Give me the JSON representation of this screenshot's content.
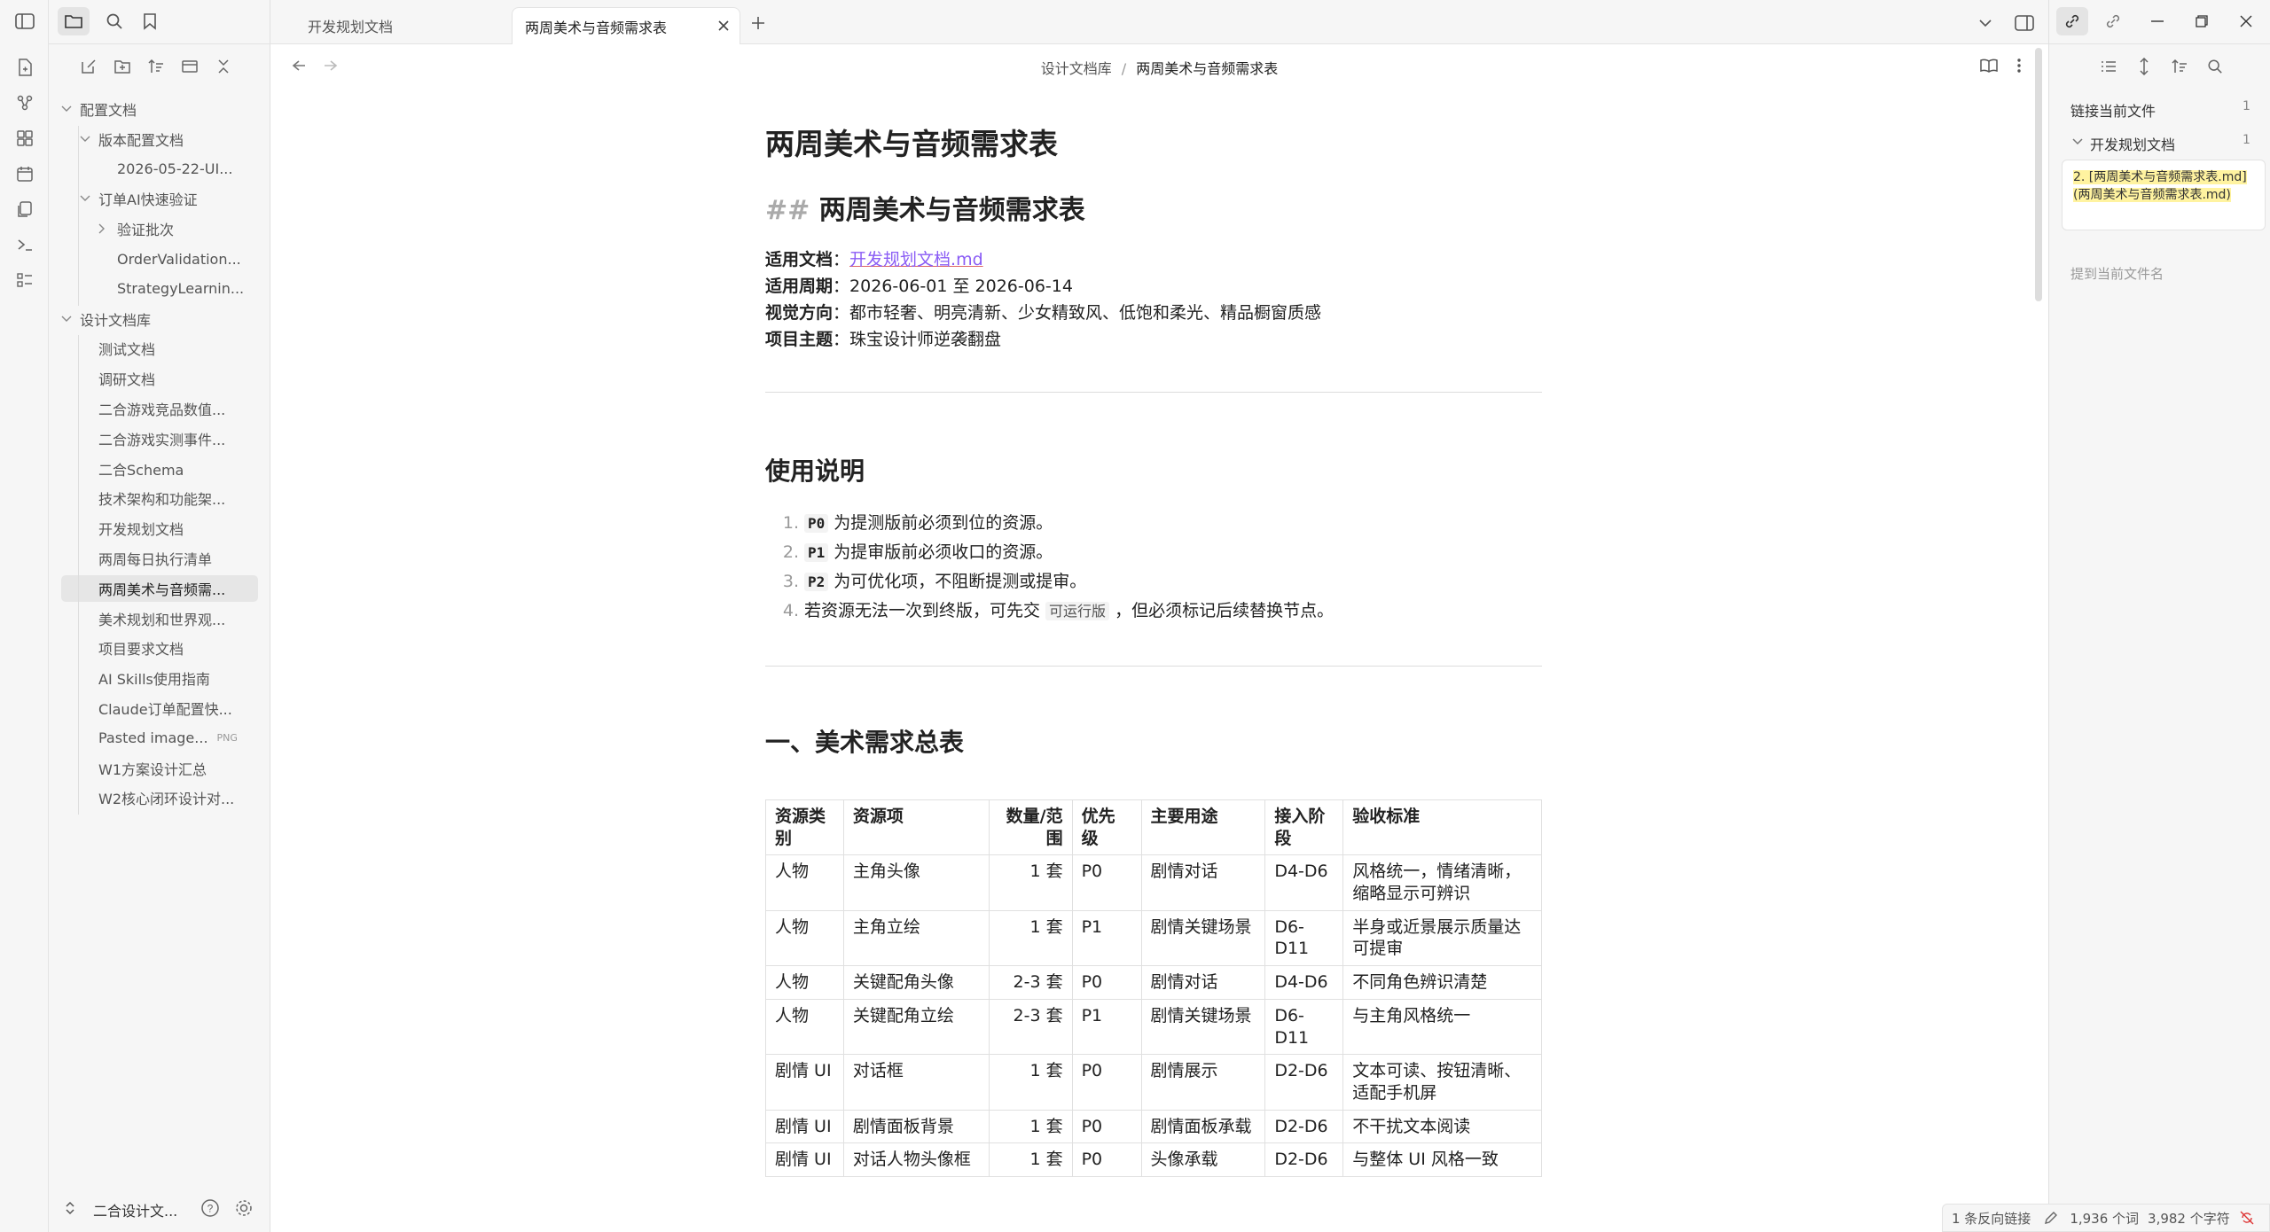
{
  "ribbon": {
    "icons": [
      "sidebar-toggle-icon",
      "new-note-icon",
      "graph-icon",
      "canvas-icon",
      "calendar-icon",
      "templates-icon",
      "terminal-icon",
      "command-palette-icon"
    ]
  },
  "sidebar": {
    "toolbar_icons": [
      "new-note-icon",
      "new-folder-icon",
      "sort-icon",
      "collapse-icon",
      "close-all-icon"
    ],
    "tree": [
      {
        "label": "配置文档",
        "depth": 0,
        "type": "folder-open"
      },
      {
        "label": "版本配置文档",
        "depth": 1,
        "type": "folder-open"
      },
      {
        "label": "2026-05-22-UI...",
        "depth": 2,
        "type": "file"
      },
      {
        "label": "订单AI快速验证",
        "depth": 1,
        "type": "folder-open"
      },
      {
        "label": "验证批次",
        "depth": 2,
        "type": "folder-closed"
      },
      {
        "label": "OrderValidation...",
        "depth": 2,
        "type": "file"
      },
      {
        "label": "StrategyLearnin...",
        "depth": 2,
        "type": "file"
      },
      {
        "label": "设计文档库",
        "depth": 0,
        "type": "folder-open"
      },
      {
        "label": "测试文档",
        "depth": 1,
        "type": "file"
      },
      {
        "label": "调研文档",
        "depth": 1,
        "type": "file"
      },
      {
        "label": "二合游戏竞品数值...",
        "depth": 1,
        "type": "file"
      },
      {
        "label": "二合游戏实测事件...",
        "depth": 1,
        "type": "file"
      },
      {
        "label": "二合Schema",
        "depth": 1,
        "type": "file"
      },
      {
        "label": "技术架构和功能架...",
        "depth": 1,
        "type": "file"
      },
      {
        "label": "开发规划文档",
        "depth": 1,
        "type": "file"
      },
      {
        "label": "两周每日执行清单",
        "depth": 1,
        "type": "file"
      },
      {
        "label": "两周美术与音频需...",
        "depth": 1,
        "type": "file",
        "selected": true
      },
      {
        "label": "美术规划和世界观...",
        "depth": 1,
        "type": "file"
      },
      {
        "label": "项目要求文档",
        "depth": 1,
        "type": "file"
      },
      {
        "label": "AI Skills使用指南",
        "depth": 1,
        "type": "file"
      },
      {
        "label": "Claude订单配置快...",
        "depth": 1,
        "type": "file"
      },
      {
        "label": "Pasted image...",
        "depth": 1,
        "type": "file",
        "badge": "PNG"
      },
      {
        "label": "W1方案设计汇总",
        "depth": 1,
        "type": "file"
      },
      {
        "label": "W2核心闭环设计对...",
        "depth": 1,
        "type": "file"
      }
    ],
    "vault_name": "二合设计文...",
    "help_icon": "help-icon",
    "settings_icon": "gear-icon"
  },
  "tabs": [
    {
      "label": "开发规划文档",
      "active": false
    },
    {
      "label": "两周美术与音频需求表",
      "active": true
    }
  ],
  "breadcrumb": {
    "folder": "设计文档库",
    "sep": "/",
    "file": "两周美术与音频需求表"
  },
  "doc": {
    "title": "两周美术与音频需求表",
    "h2_hash": "##",
    "h2_text": "两周美术与音频需求表",
    "props": [
      {
        "key": "适用文档",
        "sep": "：",
        "val": "开发规划文档.md",
        "link": true
      },
      {
        "key": "适用周期",
        "sep": "：",
        "val": "2026-06-01 至 2026-06-14"
      },
      {
        "key": "视觉方向",
        "sep": "：",
        "val": "都市轻奢、明亮清新、少女精致风、低饱和柔光、精品橱窗质感"
      },
      {
        "key": "项目主题",
        "sep": "：",
        "val": "珠宝设计师逆袭翻盘"
      }
    ],
    "usage_title": "使用说明",
    "usage_items": [
      {
        "num": "1.",
        "code": "P0",
        "text": " 为提测版前必须到位的资源。"
      },
      {
        "num": "2.",
        "code": "P1",
        "text": " 为提审版前必须收口的资源。"
      },
      {
        "num": "3.",
        "code": "P2",
        "text": " 为可优化项，不阻断提测或提审。"
      },
      {
        "num": "4.",
        "pre": "若资源无法一次到终版，可先交 ",
        "code": "可运行版",
        "text": " ，但必须标记后续替换节点。"
      }
    ],
    "section1_title": "一、美术需求总表",
    "table": {
      "headers": [
        "资源类别",
        "资源项",
        "数量/范围",
        "优先级",
        "主要用途",
        "接入阶段",
        "验收标准"
      ],
      "rows": [
        [
          "人物",
          "主角头像",
          "1 套",
          "P0",
          "剧情对话",
          "D4-D6",
          "风格统一，情绪清晰，缩略显示可辨识"
        ],
        [
          "人物",
          "主角立绘",
          "1 套",
          "P1",
          "剧情关键场景",
          "D6-D11",
          "半身或近景展示质量达可提审"
        ],
        [
          "人物",
          "关键配角头像",
          "2-3 套",
          "P0",
          "剧情对话",
          "D4-D6",
          "不同角色辨识清楚"
        ],
        [
          "人物",
          "关键配角立绘",
          "2-3 套",
          "P1",
          "剧情关键场景",
          "D6-D11",
          "与主角风格统一"
        ],
        [
          "剧情 UI",
          "对话框",
          "1 套",
          "P0",
          "剧情展示",
          "D2-D6",
          "文本可读、按钮清晰、适配手机屏"
        ],
        [
          "剧情 UI",
          "剧情面板背景",
          "1 套",
          "P0",
          "剧情面板承载",
          "D2-D6",
          "不干扰文本阅读"
        ],
        [
          "剧情 UI",
          "对话人物头像框",
          "1 套",
          "P0",
          "头像承载",
          "D2-D6",
          "与整体 UI 风格一致"
        ]
      ]
    }
  },
  "right": {
    "toolbar_icons": [
      "list-icon",
      "expand-icon",
      "sort-icon",
      "search-icon"
    ],
    "linked_title": "链接当前文件",
    "linked_count": "1",
    "group_label": "开发规划文档",
    "group_count": "1",
    "snippet": "2. [两周美术与音频需求表.md](两周美术与音频需求表.md)",
    "unlinked_label": "提到当前文件名"
  },
  "status": {
    "backlinks": "1 条反向链接",
    "words": "1,936 个词",
    "chars": "3,982 个字符"
  }
}
